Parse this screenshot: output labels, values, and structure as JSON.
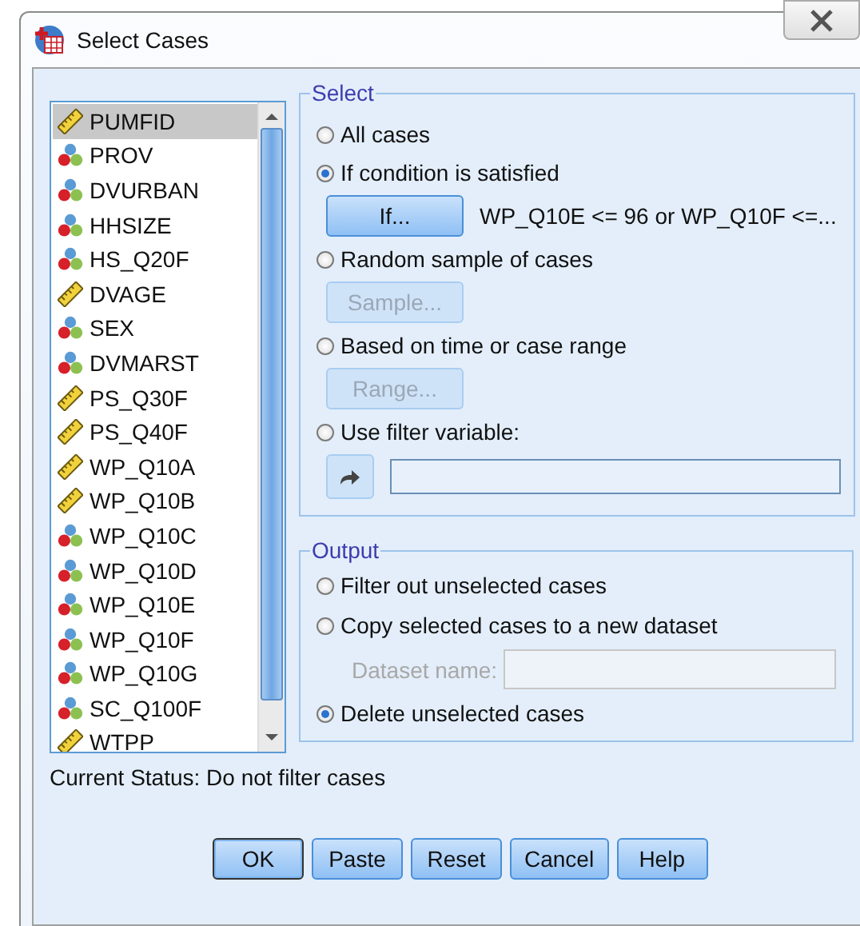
{
  "window": {
    "title": "Select Cases"
  },
  "variables": [
    {
      "name": "PUMFID",
      "kind": "scale",
      "selected": true
    },
    {
      "name": "PROV",
      "kind": "nominal",
      "selected": false
    },
    {
      "name": "DVURBAN",
      "kind": "nominal",
      "selected": false
    },
    {
      "name": "HHSIZE",
      "kind": "nominal",
      "selected": false
    },
    {
      "name": "HS_Q20F",
      "kind": "nominal",
      "selected": false
    },
    {
      "name": "DVAGE",
      "kind": "scale",
      "selected": false
    },
    {
      "name": "SEX",
      "kind": "nominal",
      "selected": false
    },
    {
      "name": "DVMARST",
      "kind": "nominal",
      "selected": false
    },
    {
      "name": "PS_Q30F",
      "kind": "scale",
      "selected": false
    },
    {
      "name": "PS_Q40F",
      "kind": "scale",
      "selected": false
    },
    {
      "name": "WP_Q10A",
      "kind": "scale",
      "selected": false
    },
    {
      "name": "WP_Q10B",
      "kind": "scale",
      "selected": false
    },
    {
      "name": "WP_Q10C",
      "kind": "nominal",
      "selected": false
    },
    {
      "name": "WP_Q10D",
      "kind": "nominal",
      "selected": false
    },
    {
      "name": "WP_Q10E",
      "kind": "nominal",
      "selected": false
    },
    {
      "name": "WP_Q10F",
      "kind": "nominal",
      "selected": false
    },
    {
      "name": "WP_Q10G",
      "kind": "nominal",
      "selected": false
    },
    {
      "name": "SC_Q100F",
      "kind": "nominal",
      "selected": false
    },
    {
      "name": "WTPP",
      "kind": "scale",
      "selected": false
    }
  ],
  "select": {
    "title": "Select",
    "options": [
      {
        "label": "All cases",
        "selected": false
      },
      {
        "label": "If condition is satisfied",
        "selected": true,
        "extra": {
          "kind": "button",
          "label": "If...",
          "disabled": false,
          "condition": "WP_Q10E <= 96 or WP_Q10F <=..."
        }
      },
      {
        "label": "Random sample of cases",
        "selected": false,
        "extra": {
          "kind": "button",
          "label": "Sample...",
          "disabled": true
        }
      },
      {
        "label": "Based on time or case range",
        "selected": false,
        "extra": {
          "kind": "button",
          "label": "Range...",
          "disabled": true
        }
      },
      {
        "label": "Use filter variable:",
        "selected": false,
        "extra": {
          "kind": "filter"
        }
      }
    ]
  },
  "output": {
    "title": "Output",
    "options": [
      {
        "label": "Filter out unselected cases",
        "selected": false
      },
      {
        "label": "Copy selected cases to a new dataset",
        "selected": false,
        "extra": {
          "kind": "dataset",
          "label": "Dataset name:",
          "disabled": true
        }
      },
      {
        "label": "Delete unselected cases",
        "selected": true
      }
    ]
  },
  "status": "Current Status: Do not filter cases",
  "buttons": [
    {
      "label": "OK",
      "default": true
    },
    {
      "label": "Paste",
      "default": false
    },
    {
      "label": "Reset",
      "default": false
    },
    {
      "label": "Cancel",
      "default": false
    },
    {
      "label": "Help",
      "default": false
    }
  ]
}
